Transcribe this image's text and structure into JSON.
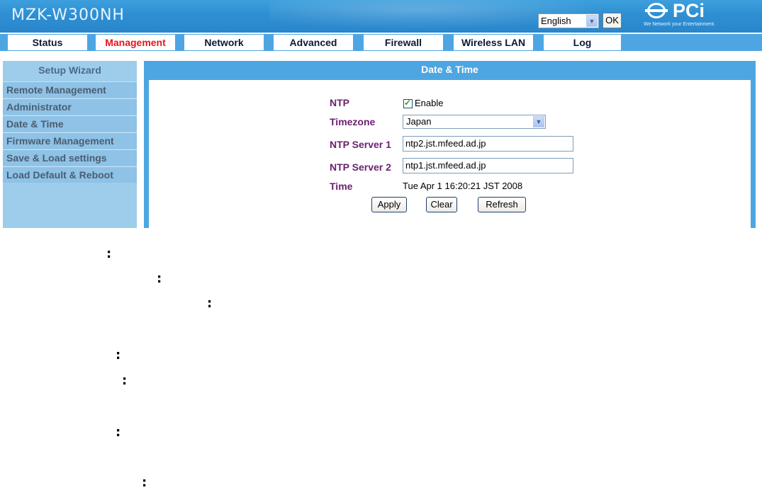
{
  "header": {
    "model": "MZK-W300NH",
    "language": "English",
    "ok_label": "OK",
    "brand": "PCi",
    "tagline": "We Network your Entertainment."
  },
  "nav": {
    "tabs": [
      {
        "label": "Status",
        "active": false
      },
      {
        "label": "Management",
        "active": true
      },
      {
        "label": "Network",
        "active": false
      },
      {
        "label": "Advanced",
        "active": false
      },
      {
        "label": "Firewall",
        "active": false
      },
      {
        "label": "Wireless LAN",
        "active": false
      },
      {
        "label": "Log",
        "active": false
      }
    ]
  },
  "sidebar": {
    "header": "Setup Wizard",
    "items": [
      "Remote Management",
      "Administrator",
      "Date & Time",
      "Firmware Management",
      "Save & Load settings",
      "Load Default & Reboot"
    ]
  },
  "panel": {
    "title": "Date & Time",
    "ntp_label": "NTP",
    "ntp_enable_label": "Enable",
    "ntp_enabled": true,
    "timezone_label": "Timezone",
    "timezone_value": "Japan",
    "server1_label": "NTP Server 1",
    "server1_value": "ntp2.jst.mfeed.ad.jp",
    "server2_label": "NTP Server 2",
    "server2_value": "ntp1.jst.mfeed.ad.jp",
    "time_label": "Time",
    "time_value": "Tue Apr 1 16:20:21 JST 2008",
    "apply_label": "Apply",
    "clear_label": "Clear",
    "refresh_label": "Refresh"
  },
  "colors": {
    "accent": "#4da6e2",
    "active_tab": "#e8141b",
    "field_label": "#6b1f6f"
  },
  "annotations": {
    "colon": ":"
  }
}
